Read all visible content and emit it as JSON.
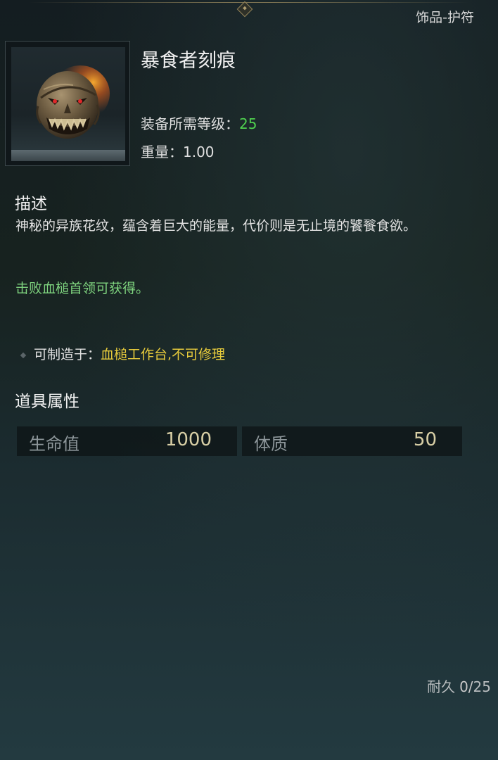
{
  "header": {
    "category": "饰品-护符"
  },
  "item": {
    "icon": "demon-mask-talisman-icon",
    "name": "暴食者刻痕",
    "level_label": "装备所需等级：",
    "level_value": "25",
    "weight_label": "重量：",
    "weight_value": "1.00"
  },
  "description": {
    "title": "描述",
    "text": "神秘的异族花纹，蕴含着巨大的能量，代价则是无止境的饕餮食欲。",
    "source": "击败血槌首领可获得。"
  },
  "crafting": {
    "label": "可制造于：",
    "value": "血槌工作台,不可修理"
  },
  "properties": {
    "title": "道具属性",
    "attributes": [
      {
        "name": "生命值",
        "value": "1000"
      },
      {
        "name": "体质",
        "value": "50"
      }
    ]
  },
  "durability": {
    "label": "耐久",
    "current": "0/",
    "max": "25"
  },
  "colors": {
    "level_value": "#4fd04f",
    "source_text": "#7fd47f",
    "craft_value": "#e8cc3c"
  }
}
